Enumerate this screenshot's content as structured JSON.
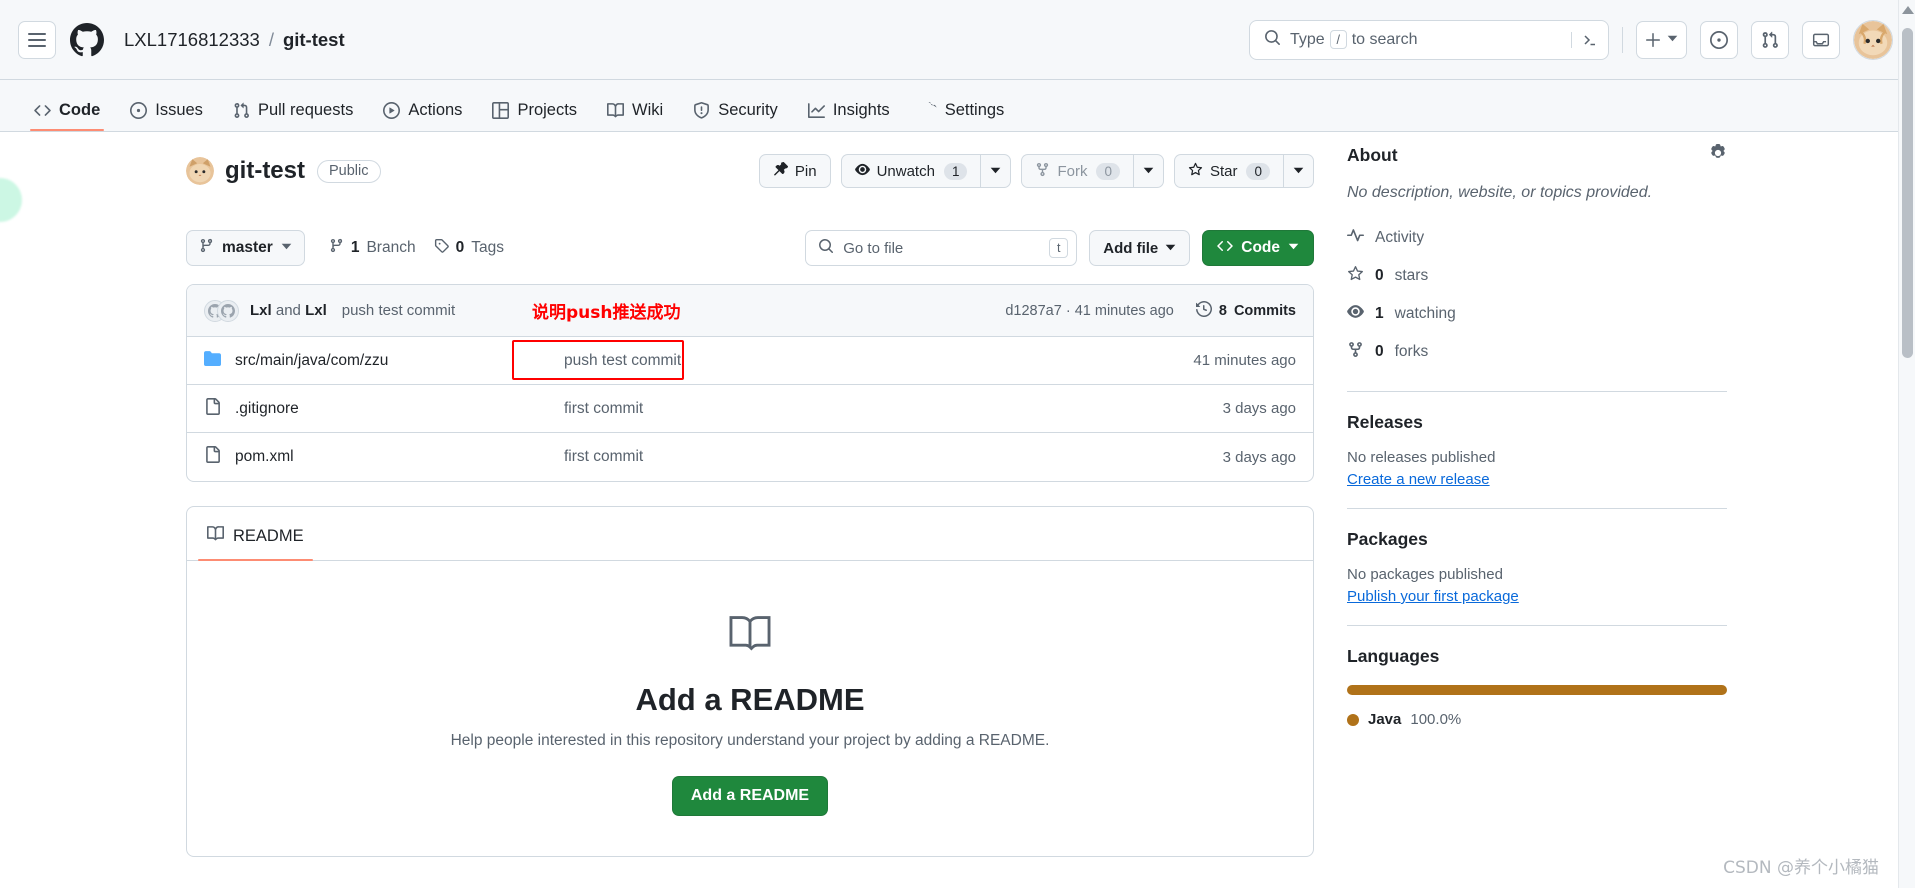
{
  "header": {
    "menu_label": "Open menu",
    "logo": "github-logo",
    "owner": "LXL1716812333",
    "separator": "/",
    "repo": "git-test",
    "search_placeholder_before": "Type",
    "search_slash_key": "/",
    "search_placeholder_after": "to search",
    "terminal_icon": "command-palette-icon",
    "create_new_label": "+",
    "issues_icon": "issues-icon",
    "pull_requests_icon": "pull-requests-icon",
    "inbox_icon": "inbox-icon",
    "avatar": "user-avatar"
  },
  "repo_nav": {
    "tabs": [
      {
        "label": "Code",
        "icon": "code-icon",
        "active": true
      },
      {
        "label": "Issues",
        "icon": "issue-opened-icon",
        "active": false
      },
      {
        "label": "Pull requests",
        "icon": "git-pull-request-icon",
        "active": false
      },
      {
        "label": "Actions",
        "icon": "play-icon",
        "active": false
      },
      {
        "label": "Projects",
        "icon": "table-icon",
        "active": false
      },
      {
        "label": "Wiki",
        "icon": "book-icon",
        "active": false
      },
      {
        "label": "Security",
        "icon": "shield-icon",
        "active": false
      },
      {
        "label": "Insights",
        "icon": "graph-icon",
        "active": false
      },
      {
        "label": "Settings",
        "icon": "gear-icon",
        "active": false
      }
    ]
  },
  "repo_header": {
    "name": "git-test",
    "visibility": "Public",
    "pin_label": "Pin",
    "watch_label": "Unwatch",
    "watch_count": "1",
    "fork_label": "Fork",
    "fork_count": "0",
    "star_label": "Star",
    "star_count": "0"
  },
  "file_toolbar": {
    "branch": "master",
    "branch_count": "1",
    "branch_word": "Branch",
    "tag_count": "0",
    "tag_word": "Tags",
    "go_to_file_placeholder": "Go to file",
    "go_to_file_key": "t",
    "add_file_label": "Add file",
    "code_label": "Code"
  },
  "commit_bar": {
    "author_primary": "Lxl",
    "conjunction": "and",
    "author_secondary": "Lxl",
    "message": "push test commit",
    "annotation": "说明push推送成功",
    "sha": "d1287a7",
    "sha_separator": "·",
    "age": "41 minutes ago",
    "commits_count": "8",
    "commits_word": "Commits"
  },
  "files": [
    {
      "name": "src/main/java/com/zzu",
      "type": "folder",
      "message": "push test commit",
      "age": "41 minutes ago",
      "highlighted": true
    },
    {
      "name": ".gitignore",
      "type": "file",
      "message": "first commit",
      "age": "3 days ago",
      "highlighted": false
    },
    {
      "name": "pom.xml",
      "type": "file",
      "message": "first commit",
      "age": "3 days ago",
      "highlighted": false
    }
  ],
  "readme": {
    "tab_label": "README",
    "empty_title": "Add a README",
    "empty_desc": "Help people interested in this repository understand your project by adding a README.",
    "cta_label": "Add a README"
  },
  "sidebar": {
    "about_title": "About",
    "about_description": "No description, website, or topics provided.",
    "items": [
      {
        "label": "Activity",
        "icon": "pulse-icon",
        "count": ""
      },
      {
        "label": "stars",
        "icon": "star-icon",
        "count": "0"
      },
      {
        "label": "watching",
        "icon": "eye-icon",
        "count": "1"
      },
      {
        "label": "forks",
        "icon": "fork-icon",
        "count": "0"
      }
    ],
    "releases_title": "Releases",
    "releases_empty": "No releases published",
    "releases_link": "Create a new release",
    "packages_title": "Packages",
    "packages_empty": "No packages published",
    "packages_link": "Publish your first package",
    "languages_title": "Languages",
    "language_name": "Java",
    "language_percent": "100.0%",
    "language_color": "#b07219"
  },
  "watermark": "CSDN @养个小橘猫"
}
